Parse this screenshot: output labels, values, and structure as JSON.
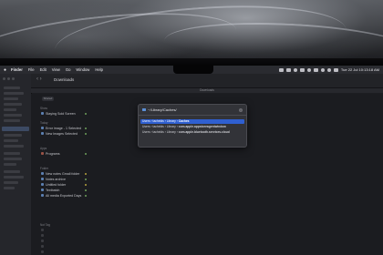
{
  "menubar": {
    "app_name": "Finder",
    "items": [
      "File",
      "Edit",
      "View",
      "Go",
      "Window",
      "Help"
    ],
    "clock": "Tue 22 Jul  10:13:18 AM"
  },
  "window": {
    "title": "Downloads",
    "path_label": "Downloads"
  },
  "content": {
    "add_label": "Shared",
    "groups": [
      {
        "label": "Show",
        "items": [
          {
            "name": "Staying Sold Screen"
          }
        ]
      },
      {
        "label": "Today",
        "items": [
          {
            "name": "Error image - 1 Selected"
          },
          {
            "name": "New Images Selected"
          }
        ]
      },
      {
        "label": "Apps",
        "items": [
          {
            "name": "Programs"
          }
        ]
      },
      {
        "label": "Folder",
        "items": [
          {
            "name": "New notes Gmall folder"
          },
          {
            "name": "Notes archive"
          },
          {
            "name": "Untitled folder"
          },
          {
            "name": "Textbatch"
          },
          {
            "name": "All media Exported Days"
          }
        ]
      },
      {
        "label": "Not Tag",
        "items": []
      }
    ]
  },
  "dialog": {
    "path_value": "~/Library/Caches/",
    "suggestions": [
      {
        "prefix": "Users › tachelds › Library › ",
        "highlight": "Caches"
      },
      {
        "prefix": "Users › tachelds › Library › ",
        "highlight": "com.apple.appstoreagentwindow"
      },
      {
        "prefix": "Users › tachelds › Library › ",
        "highlight": "com.apple.bluetooth.services.cloud"
      }
    ]
  }
}
